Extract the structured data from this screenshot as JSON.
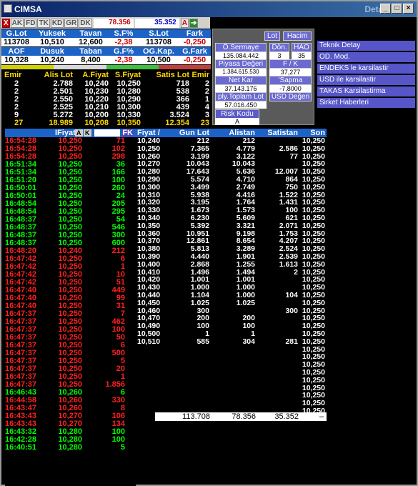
{
  "window": {
    "title": "CIMSA",
    "ghost_title": "Detay",
    "min": "_",
    "max": "□",
    "close": "×"
  },
  "toolbar": {
    "x": "X",
    "buttons": [
      "AK",
      "FD",
      "TK",
      "KD",
      "GR",
      "DK"
    ],
    "val1": "78.356",
    "val2": "35.352",
    "a": "A"
  },
  "summary": {
    "headers1": [
      "G.Lot",
      "Yuksek",
      "Tavan",
      "S.F%",
      "S.Lot",
      "Fark"
    ],
    "values1": [
      "113708",
      "10,510",
      "12,600",
      "-2,38",
      "113708",
      "-0,250"
    ],
    "headers2": [
      "AOF",
      "Dusuk",
      "Taban",
      "G.F%",
      "OG.Kap.",
      "G.Fark"
    ],
    "values2": [
      "10,328",
      "10,240",
      "8,400",
      "-2,38",
      "10,500",
      "-0,250"
    ]
  },
  "orderbook": {
    "headers": [
      "Emir",
      "Alis Lot",
      "A.Fiyat",
      "S.Fiyat",
      "Satis Lot",
      "Emir"
    ],
    "rows": [
      [
        "2",
        "2.788",
        "10,240",
        "10,250",
        "718",
        "2"
      ],
      [
        "2",
        "2.501",
        "10,230",
        "10,280",
        "538",
        "2"
      ],
      [
        "2",
        "2.550",
        "10,220",
        "10,290",
        "366",
        "1"
      ],
      [
        "2",
        "2.525",
        "10,210",
        "10,300",
        "439",
        "4"
      ],
      [
        "9",
        "5.272",
        "10,200",
        "10,330",
        "3.524",
        "3"
      ]
    ],
    "total": [
      "27",
      "18.989",
      "10,208",
      "10,350",
      "12.354",
      "23"
    ]
  },
  "panel": {
    "lot": "Lot",
    "hacim": "Hacim",
    "osermaye": "Ö.Sermaye",
    "osermaye_val": "135.084.442",
    "don": "Dön.",
    "hao": "HAO",
    "don_val": "3",
    "hao_val": "35",
    "piyasa": "Piyasa Değeri",
    "piyasa_val": "1.384.615.530",
    "fk": "F / K",
    "fk_val": "37,277",
    "netkar": "Net Kar",
    "netkar_val": "37.143.176",
    "sapma": "'Sapma",
    "sapma_val": "-7,8000",
    "plytop": "ply.Toplam Lot",
    "plytop_val": "57.016.450",
    "usd": "USD Değeri",
    "risk": "Risk Kodu",
    "risk_val": "A"
  },
  "links": [
    "Teknik Detay",
    "OD. Mod.",
    "ENDEKS le karsilastir",
    "USD ile karsilastir",
    "TAKAS Karsilastirma",
    "Sirket Haberleri"
  ],
  "trades": {
    "header": "IFiyat",
    "a": "A",
    "k": "K",
    "fk": "FK",
    "rows": [
      [
        "16:54:28",
        "10,250",
        "71",
        "r"
      ],
      [
        "16:54:28",
        "10,250",
        "102",
        "r"
      ],
      [
        "16:54:28",
        "10,250",
        "298",
        "r"
      ],
      [
        "16:51:34",
        "10,250",
        "36",
        "g"
      ],
      [
        "16:51:34",
        "10,250",
        "166",
        "g"
      ],
      [
        "16:51:20",
        "10,250",
        "100",
        "g"
      ],
      [
        "16:50:01",
        "10,250",
        "260",
        "g"
      ],
      [
        "16:50:01",
        "10,250",
        "24",
        "g"
      ],
      [
        "16:48:54",
        "10,250",
        "205",
        "g"
      ],
      [
        "16:48:54",
        "10,250",
        "295",
        "g"
      ],
      [
        "16:48:37",
        "10,250",
        "54",
        "g"
      ],
      [
        "16:48:37",
        "10,250",
        "546",
        "g"
      ],
      [
        "16:48:37",
        "10,250",
        "300",
        "g"
      ],
      [
        "16:48:37",
        "10,250",
        "600",
        "g"
      ],
      [
        "16:48:20",
        "10,240",
        "212",
        "r"
      ],
      [
        "16:47:42",
        "10,250",
        "6",
        "r"
      ],
      [
        "16:47:42",
        "10,250",
        "1",
        "r"
      ],
      [
        "16:47:42",
        "10,250",
        "10",
        "r"
      ],
      [
        "16:47:42",
        "10,250",
        "51",
        "r"
      ],
      [
        "16:47:40",
        "10,250",
        "449",
        "r"
      ],
      [
        "16:47:40",
        "10,250",
        "99",
        "r"
      ],
      [
        "16:47:40",
        "10,250",
        "31",
        "r"
      ],
      [
        "16:47:37",
        "10,250",
        "7",
        "r"
      ],
      [
        "16:47:37",
        "10,250",
        "462",
        "r"
      ],
      [
        "16:47:37",
        "10,250",
        "100",
        "r"
      ],
      [
        "16:47:37",
        "10,250",
        "50",
        "r"
      ],
      [
        "16:47:37",
        "10,250",
        "6",
        "r"
      ],
      [
        "16:47:37",
        "10,250",
        "500",
        "r"
      ],
      [
        "16:47:37",
        "10,250",
        "5",
        "r"
      ],
      [
        "16:47:37",
        "10,250",
        "20",
        "r"
      ],
      [
        "16:47:37",
        "10,250",
        "1",
        "r"
      ],
      [
        "16:47:37",
        "10,250",
        "1.856",
        "r"
      ],
      [
        "16:46:43",
        "10,260",
        "6",
        "g"
      ],
      [
        "16:44:58",
        "10,260",
        "330",
        "r"
      ],
      [
        "16:43:47",
        "10,260",
        "8",
        "r"
      ],
      [
        "16:43:43",
        "10,270",
        "106",
        "r"
      ],
      [
        "16:43:43",
        "10,270",
        "134",
        "r"
      ],
      [
        "16:43:32",
        "10,280",
        "100",
        "g"
      ],
      [
        "16:42:28",
        "10,280",
        "100",
        "g"
      ],
      [
        "16:40:51",
        "10,280",
        "5",
        "g"
      ]
    ]
  },
  "depth": {
    "headers": [
      "Fiyat /",
      "Gun Lot",
      "Alistan",
      "Satistan",
      "Son"
    ],
    "rows": [
      [
        "10,240",
        "212",
        "212",
        "",
        "10,250"
      ],
      [
        "10,250",
        "7.365",
        "4.779",
        "2.586",
        "10,250"
      ],
      [
        "10,260",
        "3.199",
        "3.122",
        "77",
        "10,250"
      ],
      [
        "10,270",
        "10.043",
        "10.043",
        "",
        "10,250"
      ],
      [
        "10,280",
        "17.643",
        "5.636",
        "12.007",
        "10,250"
      ],
      [
        "10,290",
        "5.574",
        "4.710",
        "864",
        "10,250"
      ],
      [
        "10,300",
        "3.499",
        "2.749",
        "750",
        "10,250"
      ],
      [
        "10,310",
        "5.938",
        "4.416",
        "1.522",
        "10,250"
      ],
      [
        "10,320",
        "3.195",
        "1.764",
        "1.431",
        "10,250"
      ],
      [
        "10,330",
        "1.673",
        "1.573",
        "100",
        "10,250"
      ],
      [
        "10,340",
        "6.230",
        "5.609",
        "621",
        "10,250"
      ],
      [
        "10,350",
        "5.392",
        "3.321",
        "2.071",
        "10,250"
      ],
      [
        "10,360",
        "10.951",
        "9.198",
        "1.753",
        "10,250"
      ],
      [
        "10,370",
        "12.861",
        "8.654",
        "4.207",
        "10,250"
      ],
      [
        "10,380",
        "5.813",
        "3.289",
        "2.524",
        "10,250"
      ],
      [
        "10,390",
        "4.440",
        "1.901",
        "2.539",
        "10,250"
      ],
      [
        "10,400",
        "2.868",
        "1.255",
        "1.613",
        "10,250"
      ],
      [
        "10,410",
        "1.496",
        "1.494",
        "2",
        "10,250"
      ],
      [
        "10,420",
        "1.001",
        "1.001",
        "",
        "10,250"
      ],
      [
        "10,430",
        "1.000",
        "1.000",
        "",
        "10,250"
      ],
      [
        "10,440",
        "1.104",
        "1.000",
        "104",
        "10,250"
      ],
      [
        "10,450",
        "1.025",
        "1.025",
        "",
        "10,250"
      ],
      [
        "10,460",
        "300",
        "",
        "300",
        "10,250"
      ],
      [
        "10,470",
        "200",
        "200",
        "",
        "10,250"
      ],
      [
        "10,490",
        "100",
        "100",
        "",
        "10,250"
      ],
      [
        "10,500",
        "1",
        "1",
        "",
        "10,250"
      ],
      [
        "10,510",
        "585",
        "304",
        "281",
        "10,250"
      ],
      [
        "",
        "",
        "",
        "",
        "10,250"
      ],
      [
        "",
        "",
        "",
        "",
        "10,250"
      ],
      [
        "",
        "",
        "",
        "",
        "10,250"
      ],
      [
        "",
        "",
        "",
        "",
        "10,250"
      ],
      [
        "",
        "",
        "",
        "",
        "10,250"
      ],
      [
        "",
        "",
        "",
        "",
        "10,250"
      ],
      [
        "",
        "",
        "",
        "",
        "10,250"
      ],
      [
        "",
        "",
        "",
        "",
        "10,250"
      ],
      [
        "",
        "",
        "",
        "",
        "10,250"
      ]
    ],
    "totals": [
      "113.708",
      "78.356",
      "35.352",
      "–"
    ]
  }
}
